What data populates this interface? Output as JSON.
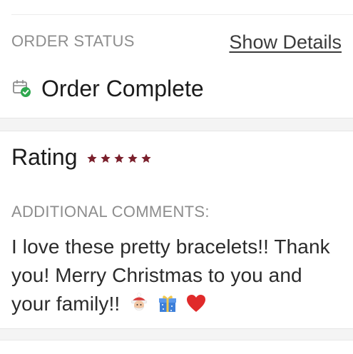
{
  "order_status": {
    "section_label": "ORDER STATUS",
    "show_details_label": "Show Details",
    "status_text": "Order Complete",
    "status_icon": "order-complete-icon",
    "status_icon_color": "#2fa84f"
  },
  "rating": {
    "label": "Rating",
    "stars": 5,
    "max_stars": 5,
    "star_color": "#7a1f2b"
  },
  "additional_comments": {
    "section_label": "ADDITIONAL COMMENTS:",
    "text": "I love these pretty bracelets!! Thank you! Merry Christmas to you and your family!!",
    "emojis": [
      "santa-emoji",
      "gift-emoji",
      "heart-emoji"
    ]
  }
}
